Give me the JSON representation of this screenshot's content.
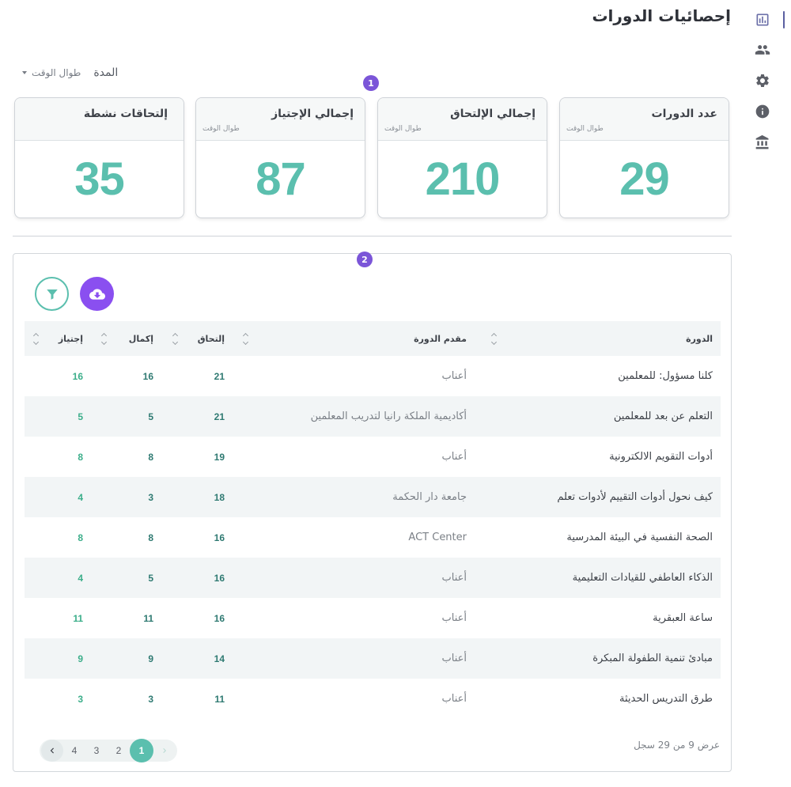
{
  "page": {
    "title": "إحصائيات الدورات"
  },
  "nav": {
    "items": [
      {
        "name": "statistics",
        "icon": "bar-chart-icon",
        "active": true
      },
      {
        "name": "users",
        "icon": "people-icon",
        "active": false
      },
      {
        "name": "settings",
        "icon": "gear-icon",
        "active": false
      },
      {
        "name": "info",
        "icon": "info-icon",
        "active": false
      },
      {
        "name": "institution",
        "icon": "bank-icon",
        "active": false
      }
    ]
  },
  "filters": {
    "period_label": "المدة",
    "period_value": "طوال الوقت"
  },
  "badges": {
    "one": "1",
    "two": "2"
  },
  "stats": [
    {
      "title": "عدد الدورات",
      "subtitle": "طوال الوقت",
      "value": "29"
    },
    {
      "title": "إجمالي الإلتحاق",
      "subtitle": "طوال الوقت",
      "value": "210"
    },
    {
      "title": "إجمالي الإجتياز",
      "subtitle": "طوال الوقت",
      "value": "87"
    },
    {
      "title": "إلتحاقات نشطة",
      "subtitle": "",
      "value": "35"
    }
  ],
  "table": {
    "columns": {
      "course": "الدورة",
      "provider": "مقدم الدورة",
      "enrolled": "إلتحاق",
      "completed": "إكمال",
      "passed": "إجتياز"
    },
    "rows": [
      {
        "course": "كلنا مسؤول: للمعلمين",
        "provider": "أعناب",
        "enrolled": "21",
        "completed": "16",
        "passed": "16"
      },
      {
        "course": "التعلم عن بعد للمعلمين",
        "provider": "أكاديمية الملكة رانيا لتدريب المعلمين",
        "enrolled": "21",
        "completed": "5",
        "passed": "5"
      },
      {
        "course": "أدوات التقويم الالكترونية",
        "provider": "أعناب",
        "enrolled": "19",
        "completed": "8",
        "passed": "8"
      },
      {
        "course": "كيف نحول أدوات التقييم لأدوات تعلم",
        "provider": "جامعة دار الحكمة",
        "enrolled": "18",
        "completed": "3",
        "passed": "4"
      },
      {
        "course": "الصحة النفسية في البيئة المدرسية",
        "provider": "ACT Center",
        "enrolled": "16",
        "completed": "8",
        "passed": "8"
      },
      {
        "course": "الذكاء العاطفي للقيادات التعليمية",
        "provider": "أعناب",
        "enrolled": "16",
        "completed": "5",
        "passed": "4"
      },
      {
        "course": "ساعة العبقرية",
        "provider": "أعناب",
        "enrolled": "16",
        "completed": "11",
        "passed": "11"
      },
      {
        "course": "مبادئ تنمية الطفولة المبكرة",
        "provider": "أعناب",
        "enrolled": "14",
        "completed": "9",
        "passed": "9"
      },
      {
        "course": "طرق التدريس الحديثة",
        "provider": "أعناب",
        "enrolled": "11",
        "completed": "3",
        "passed": "3"
      }
    ]
  },
  "footer": {
    "records": "عرض 9 من 29 سجل"
  },
  "pagination": {
    "pages": [
      "1",
      "2",
      "3",
      "4"
    ],
    "current": "1"
  },
  "colors": {
    "accent": "#5bbfae",
    "purple": "#8a4ff0",
    "badge": "#7b55d8"
  }
}
